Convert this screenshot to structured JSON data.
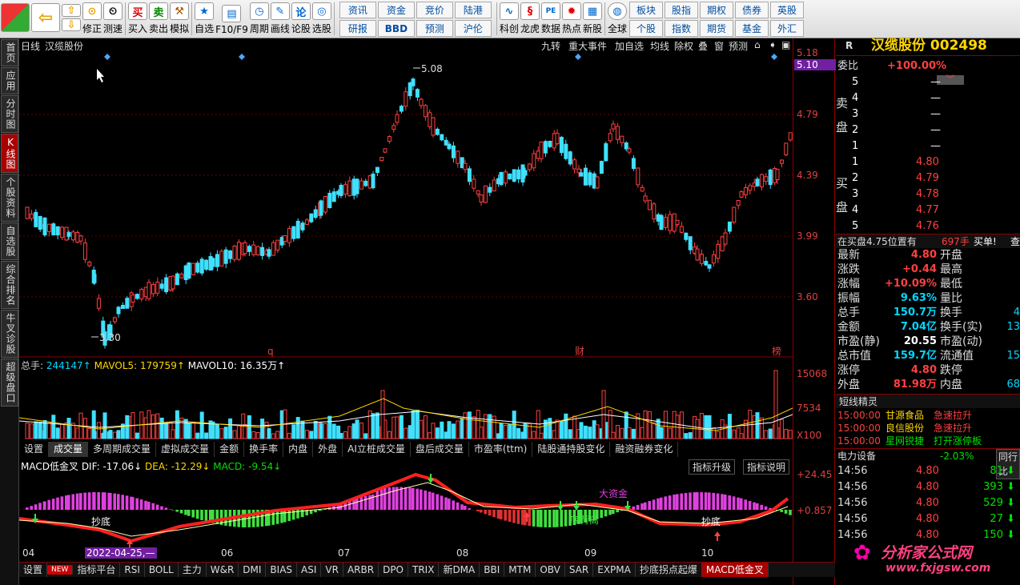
{
  "toolbar": {
    "left": [
      "修正",
      "测速",
      "买入",
      "卖出",
      "模拟",
      "自选",
      "F10/F9",
      "周期",
      "画线",
      "论股",
      "选股"
    ],
    "grid1": [
      "资讯",
      "资金",
      "竞价",
      "陆港",
      "研报",
      "BBD",
      "预测",
      "沪伦"
    ],
    "grid2labels": [
      "科创",
      "龙虎",
      "数据",
      "热点",
      "新股"
    ],
    "grid3": [
      "全球",
      "板块",
      "股指",
      "期权",
      "债券",
      "英股",
      "个股",
      "指数",
      "期货",
      "基金",
      "外汇"
    ]
  },
  "leftbar": [
    "首页",
    "应用",
    "分时图",
    "K线图",
    "个股资料",
    "自选股",
    "综合排名",
    "牛叉诊股",
    "超级盘口"
  ],
  "chart_header": {
    "period": "日线",
    "name": "汉缆股份",
    "buttons": [
      "九转",
      "重大事件",
      "加自选",
      "均线",
      "除权",
      "叠",
      "窗",
      "预测"
    ]
  },
  "price_axis": {
    "ticks": [
      "5.18",
      "5.10",
      "4.79",
      "4.39",
      "3.99",
      "3.60"
    ],
    "current": "5.10"
  },
  "annotations": {
    "high": "5.08",
    "low": "3.30",
    "events": [
      "q",
      "财",
      "榜"
    ]
  },
  "volume": {
    "total_label": "总手:",
    "total": "244147↑",
    "ma5_label": "MAVOL5:",
    "ma5": "179759↑",
    "ma10_label": "MAVOL10:",
    "ma10": "16.35万↑",
    "ticks": [
      "15068",
      "7534",
      "X100"
    ]
  },
  "indicator_tabs": [
    "设置",
    "成交量",
    "多周期成交量",
    "虚拟成交量",
    "金额",
    "换手率",
    "内盘",
    "外盘",
    "AI立桩成交量",
    "盘后成交量",
    "市盈率(ttm)",
    "陆股通持股变化",
    "融资融券变化"
  ],
  "macd": {
    "name": "MACD低金叉",
    "dif_label": "DIF:",
    "dif": "-17.06↓",
    "dea_label": "DEA:",
    "dea": "-12.29↓",
    "macd_label": "MACD:",
    "macd": "-9.54↓",
    "btn1": "指标升级",
    "btn2": "指标说明",
    "ticks": [
      "+24.45",
      "+0.857"
    ],
    "labels": [
      "抄底",
      "底背离",
      "大资金",
      "抄底"
    ]
  },
  "dates": [
    "04",
    "2022-04-25,—",
    "06",
    "07",
    "08",
    "09",
    "10"
  ],
  "bottom_tabs": [
    "设置",
    "NEW",
    "指标平台",
    "RSI",
    "BOLL",
    "主力",
    "W&R",
    "DMI",
    "BIAS",
    "ASI",
    "VR",
    "ARBR",
    "DPO",
    "TRIX",
    "新DMA",
    "BBI",
    "MTM",
    "OBV",
    "SAR",
    "EXPMA",
    "抄底拐点起爆",
    "MACD低金叉"
  ],
  "quote": {
    "title": "汉缆股份 002498",
    "r": "R",
    "weibi_label": "委比",
    "weibi": "+100.00%",
    "sell": [
      [
        "5",
        "—"
      ],
      [
        "4",
        "—"
      ],
      [
        "3",
        "—"
      ],
      [
        "2",
        "—"
      ],
      [
        "1",
        "—"
      ]
    ],
    "sell_label": [
      "卖",
      "盘"
    ],
    "buy": [
      [
        "1",
        "4.80"
      ],
      [
        "2",
        "4.79"
      ],
      [
        "3",
        "4.78"
      ],
      [
        "4",
        "4.77"
      ],
      [
        "5",
        "4.76"
      ]
    ],
    "buy_label": [
      "买",
      "盘"
    ],
    "info_line": "在买盘4.75位置有",
    "info_qty": "697手",
    "info_act": "买单!",
    "info_more": "查",
    "fields": [
      [
        "最新",
        "4.80",
        "开盘",
        ""
      ],
      [
        "涨跌",
        "+0.44",
        "最高",
        ""
      ],
      [
        "涨幅",
        "+10.09%",
        "最低",
        ""
      ],
      [
        "振幅",
        "9.63%",
        "量比",
        ""
      ],
      [
        "总手",
        "150.7万",
        "换手",
        "4"
      ],
      [
        "金额",
        "7.04亿",
        "换手(实)",
        "13"
      ],
      [
        "市盈(静)",
        "20.55",
        "市盈(动)",
        ""
      ],
      [
        "总市值",
        "159.7亿",
        "流通值",
        "15"
      ],
      [
        "涨停",
        "4.80",
        "跌停",
        ""
      ],
      [
        "外盘",
        "81.98万",
        "内盘",
        "68"
      ]
    ],
    "sprite_title": "短线精灵",
    "sprites": [
      [
        "15:00:00",
        "甘源食品",
        "急速拉升"
      ],
      [
        "15:00:00",
        "良信股份",
        "急速拉升"
      ],
      [
        "15:00:00",
        "星网锐捷",
        "打开涨停板"
      ]
    ],
    "sector": "电力设备",
    "sector_chg": "-2.03%",
    "sector_btn": "同行比",
    "ticks": [
      [
        "14:56",
        "4.80",
        "81"
      ],
      [
        "14:56",
        "4.80",
        "393"
      ],
      [
        "14:56",
        "4.80",
        "529"
      ],
      [
        "14:56",
        "4.80",
        "27"
      ],
      [
        "14:56",
        "4.80",
        "150"
      ]
    ]
  },
  "watermark": {
    "cn": "分析家公式网",
    "url": "www.fxjgsw.com"
  }
}
